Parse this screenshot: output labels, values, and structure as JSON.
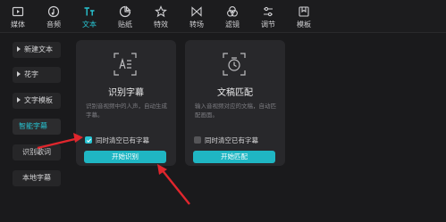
{
  "toolbar": {
    "tabs": [
      {
        "label": "媒体",
        "icon": "media-icon"
      },
      {
        "label": "音频",
        "icon": "audio-icon"
      },
      {
        "label": "文本",
        "icon": "text-icon",
        "active": true
      },
      {
        "label": "贴纸",
        "icon": "sticker-icon"
      },
      {
        "label": "特效",
        "icon": "effects-icon"
      },
      {
        "label": "转场",
        "icon": "transition-icon"
      },
      {
        "label": "滤镜",
        "icon": "filter-icon"
      },
      {
        "label": "调节",
        "icon": "adjust-icon"
      },
      {
        "label": "模板",
        "icon": "template-icon"
      }
    ]
  },
  "sidebar": {
    "items": [
      {
        "label": "新建文本"
      },
      {
        "label": "花字"
      },
      {
        "label": "文字模板"
      },
      {
        "label": "智能字幕",
        "active": true
      },
      {
        "label": "识别歌词"
      },
      {
        "label": "本地字幕"
      }
    ]
  },
  "cards": [
    {
      "title": "识别字幕",
      "desc": "识别音视频中的人声，自动生成字幕。",
      "checkbox_label": "同时清空已有字幕",
      "checked": true,
      "button_label": "开始识别"
    },
    {
      "title": "文稿匹配",
      "desc": "输入音视频对应的文稿，自动匹配画面。",
      "checkbox_label": "同时清空已有字幕",
      "checked": false,
      "button_label": "开始匹配"
    }
  ],
  "colors": {
    "accent": "#27c5d3",
    "button": "#1fb6c3",
    "annotation_arrow": "#e0262d",
    "background": "#1a1a1c",
    "card": "#28282b"
  }
}
